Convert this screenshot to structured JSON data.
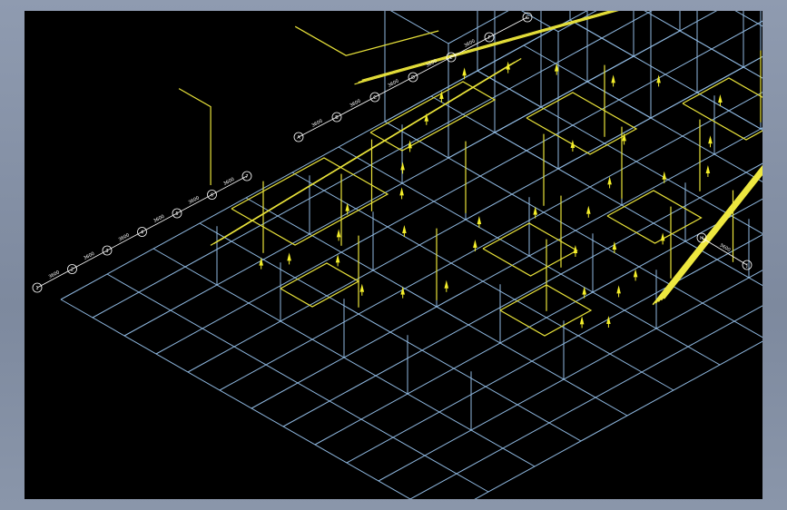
{
  "drawing": {
    "type": "isometric-plumbing-drawing",
    "background": "#000000",
    "frame_color": "#8e9ab0",
    "grid_color": "#8fb8e0",
    "pipe_color": "#e8e23a",
    "fixture_color": "#f4ee2a"
  },
  "left_axis": {
    "bubbles": [
      "1",
      "2",
      "3",
      "4",
      "5",
      "6",
      "7"
    ],
    "dimensions": [
      "3600",
      "3600",
      "3600",
      "3600",
      "3600",
      "3600"
    ]
  },
  "top_axis": {
    "bubbles": [
      "A",
      "B",
      "C",
      "D",
      "E",
      "F",
      "G"
    ],
    "dimensions": [
      "3600",
      "3600",
      "3600",
      "3600",
      "3600"
    ]
  },
  "right_axis": {
    "bubbles": [
      "H",
      "J"
    ],
    "dimensions": [
      "3600"
    ]
  }
}
